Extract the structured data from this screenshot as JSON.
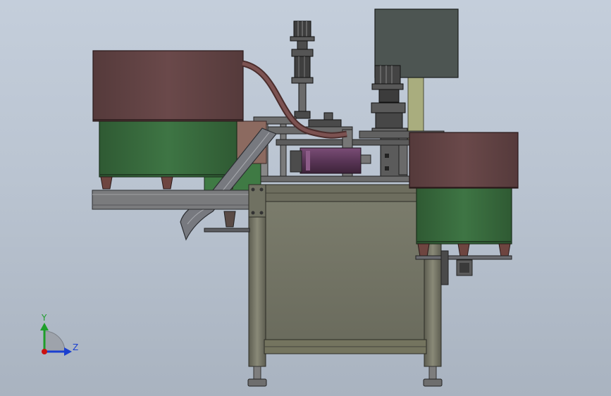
{
  "colors": {
    "background_top": "#c4cedb",
    "background_bottom": "#a9b3c0",
    "hopper_brown": "#5f4142",
    "bowl_green": "#3b6d3f",
    "frame_olive": "#6f6f60",
    "control_box": "#4d5552",
    "motor_purple": "#5e3b5c",
    "column_khaki": "#a9ad7e",
    "axis_y": "#1e9e2a",
    "axis_z": "#1a3fd0",
    "axis_origin": "#cc1111"
  },
  "triad": {
    "y_label": "Y",
    "z_label": "Z"
  }
}
